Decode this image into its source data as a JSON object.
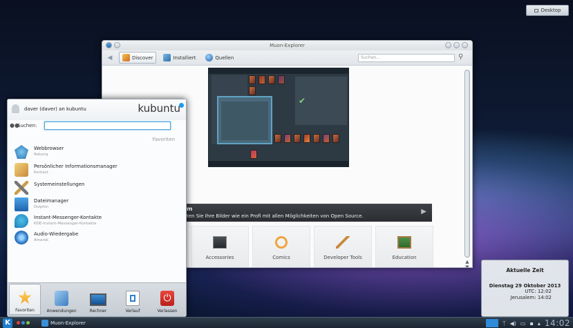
{
  "desktop_button": {
    "label": "Desktop"
  },
  "muon": {
    "title": "Muon-Explorer",
    "toolbar": {
      "discover": "Discover",
      "installiert": "Installiert",
      "quellen": "Quellen",
      "search_placeholder": "Suchen..."
    },
    "banner": {
      "title": "m",
      "text": "ten Sie Ihre Bilder wie ein Profi mit allen Möglichkeiten von Open Source."
    },
    "categories": [
      {
        "label": "Accessories",
        "icon": "terminal-icon"
      },
      {
        "label": "Comics",
        "icon": "comics-icon"
      },
      {
        "label": "Developer Tools",
        "icon": "developer-tools-icon"
      },
      {
        "label": "Education",
        "icon": "education-icon"
      },
      {
        "label": "",
        "icon": "office-icon"
      },
      {
        "label": "",
        "icon": "graphics-icon"
      },
      {
        "label": "",
        "icon": "internet-icon"
      },
      {
        "label": "",
        "icon": "multimedia-icon"
      }
    ]
  },
  "kickoff": {
    "user": "daver (daver) an kubuntu",
    "logo": "kubuntu",
    "search_label": "Suchen:",
    "favorites_title": "Favoriten",
    "items": [
      {
        "title": "Webbrowser",
        "subtitle": "Rekonq",
        "icon": "webbrowser-icon"
      },
      {
        "title": "Persönlicher Informationsmanager",
        "subtitle": "Kontact",
        "icon": "pim-icon"
      },
      {
        "title": "Systemeinstellungen",
        "subtitle": "",
        "icon": "settings-icon"
      },
      {
        "title": "Dateimanager",
        "subtitle": "Dolphin",
        "icon": "filemanager-icon"
      },
      {
        "title": "Instant-Messenger-Kontakte",
        "subtitle": "KDE-Instant-Messenger-Kontakte",
        "icon": "messenger-icon"
      },
      {
        "title": "Audio-Wiedergabe",
        "subtitle": "Amarok",
        "icon": "audio-icon"
      }
    ],
    "tabs": [
      {
        "label": "Favoriten",
        "icon": "star-icon"
      },
      {
        "label": "Anwendungen",
        "icon": "applications-icon"
      },
      {
        "label": "Rechner",
        "icon": "computer-icon"
      },
      {
        "label": "Verlauf",
        "icon": "history-icon"
      },
      {
        "label": "Verlassen",
        "icon": "power-icon"
      }
    ]
  },
  "clock_popup": {
    "title": "Aktuelle Zeit",
    "date": "Dienstag 29 Oktober 2013",
    "utc": "UTC: 12:02",
    "jerusalem": "Jerusalem: 14:02"
  },
  "taskbar": {
    "task": "Muon-Explorer",
    "time": "14:02"
  },
  "colors": {
    "accent": "#1d99f3",
    "banner": "#2e3135",
    "power": "#d9312b"
  }
}
